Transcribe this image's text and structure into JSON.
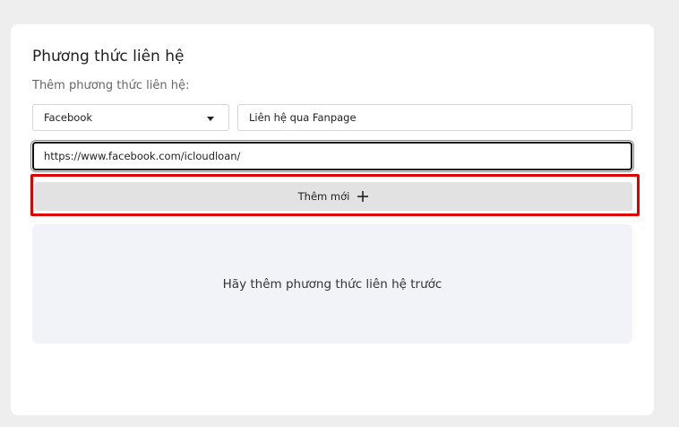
{
  "contact_section": {
    "title": "Phương thức liên hệ",
    "subtitle": "Thêm phương thức liên hệ:",
    "type_select": {
      "selected": "Facebook"
    },
    "label_input": {
      "value": "Liên hệ qua Fanpage"
    },
    "url_input": {
      "value": "https://www.facebook.com/icloudloan/"
    },
    "add_button": {
      "label": "Thêm mới",
      "icon": "plus-icon"
    },
    "empty_state": {
      "message": "Hãy thêm phương thức liên hệ trước"
    }
  },
  "colors": {
    "highlight": "#e00000",
    "button_bg": "#e2e2e2",
    "empty_bg": "#f1f3f8",
    "page_bg": "#eeeeee"
  }
}
